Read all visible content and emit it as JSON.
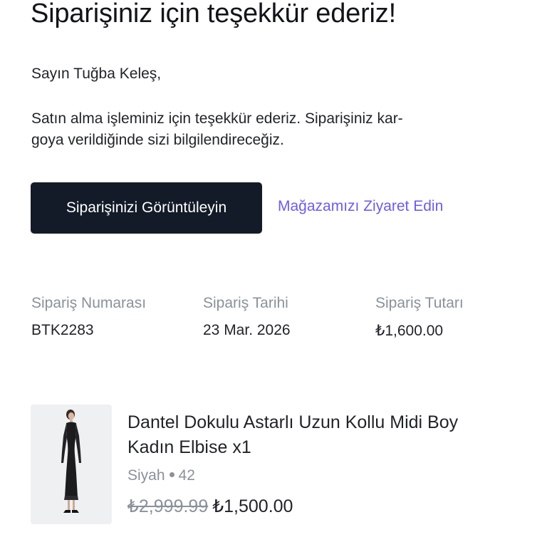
{
  "email": {
    "title": "Siparişiniz için teşekkür ederiz!",
    "greeting": "Sayın Tuğba Keleş,",
    "message_lines": [
      "Satın alma işleminiz için teşekkür ederiz. Siparişiniz kar-",
      "goya verildiğinde sizi bilgilendireceğiz."
    ],
    "actions": {
      "view_order_label": "Siparişinizi Görüntüleyin",
      "visit_store_label": "Mağazamızı Ziyaret Edin"
    },
    "summary": [
      {
        "label": "Sipariş Numarası",
        "value": "BTK2283"
      },
      {
        "label": "Sipariş Tarihi",
        "value": "23 Mar. 2026"
      },
      {
        "label": "Sipariş Tutarı",
        "value": "₺1,600.00"
      }
    ],
    "product": {
      "name_lines": [
        "Dantel Dokulu Astarlı Uzun Kollu Midi Boy",
        "Kadın Elbise x1"
      ],
      "color": "Siyah",
      "size": "42",
      "original_price": "₺2,999.99",
      "price": "₺1,500.00",
      "image": "black lace midi dress product photo"
    }
  },
  "colors": {
    "primary_button": "#141b28",
    "link": "#6b5cf0",
    "muted_text": "#8a919b",
    "body_text": "#1f2328"
  }
}
